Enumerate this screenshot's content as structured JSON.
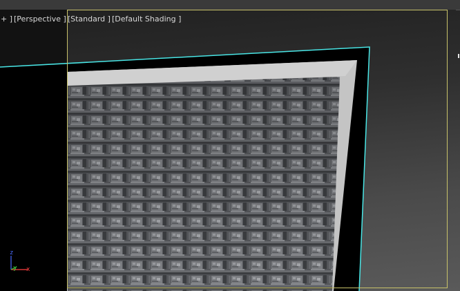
{
  "viewport": {
    "labels": {
      "plus_menu": "+ ]",
      "view_mode": "[Perspective ]",
      "render_style": "[Standard ]",
      "shading_mode": "[Default Shading ]"
    },
    "axis_tripod": {
      "z": "z",
      "y": "y",
      "x": "x"
    }
  },
  "colors": {
    "background_top": "#1f1f1f",
    "background_bottom": "#5a5a5a",
    "selection_outline": "#49e6e6",
    "safe_frame": "#c9c36a",
    "mesh_border": "#c4c4c4",
    "mesh_panel": "#5a5c60",
    "label_text": "#d8d8d8"
  },
  "scene": {
    "object": "textured-panel",
    "selected": true
  }
}
